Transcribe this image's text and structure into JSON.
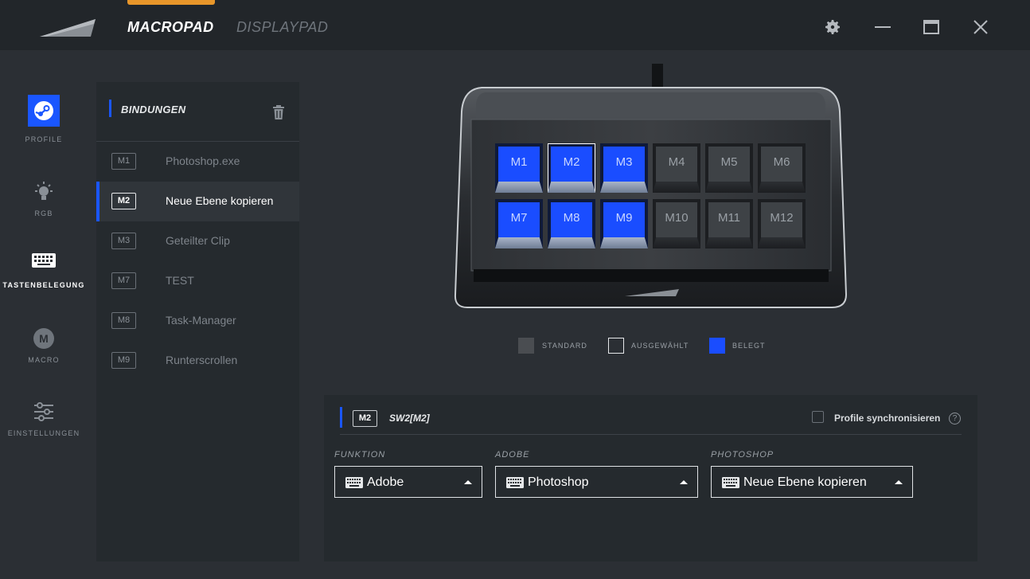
{
  "header": {
    "tab_active": "MACROPAD",
    "tab_inactive": "DISPLAYPAD",
    "accent_color": "#e8962a"
  },
  "nav": {
    "items": [
      {
        "label": "PROFILE",
        "icon": "steam-icon"
      },
      {
        "label": "RGB",
        "icon": "lightbulb-icon"
      },
      {
        "label": "TASTENBELEGUNG",
        "icon": "keyboard-icon"
      },
      {
        "label": "MACRO",
        "icon": "macro-m-icon"
      },
      {
        "label": "EINSTELLUNGEN",
        "icon": "sliders-icon"
      }
    ]
  },
  "bindings": {
    "title": "BINDUNGEN",
    "rows": [
      {
        "key": "M1",
        "label": "Photoshop.exe"
      },
      {
        "key": "M2",
        "label": "Neue Ebene kopieren",
        "selected": true
      },
      {
        "key": "M3",
        "label": "Geteilter Clip"
      },
      {
        "key": "M7",
        "label": "TEST"
      },
      {
        "key": "M8",
        "label": "Task-Manager"
      },
      {
        "key": "M9",
        "label": "Runterscrollen"
      }
    ]
  },
  "keys": [
    {
      "label": "M1",
      "state": "assigned"
    },
    {
      "label": "M2",
      "state": "assigned",
      "selected": true
    },
    {
      "label": "M3",
      "state": "assigned"
    },
    {
      "label": "M4",
      "state": "standard"
    },
    {
      "label": "M5",
      "state": "standard"
    },
    {
      "label": "M6",
      "state": "standard"
    },
    {
      "label": "M7",
      "state": "assigned"
    },
    {
      "label": "M8",
      "state": "assigned"
    },
    {
      "label": "M9",
      "state": "assigned"
    },
    {
      "label": "M10",
      "state": "standard"
    },
    {
      "label": "M11",
      "state": "standard"
    },
    {
      "label": "M12",
      "state": "standard"
    }
  ],
  "legend": {
    "standard": "STANDARD",
    "selected": "AUSGEWÄHLT",
    "assigned": "BELEGT",
    "assigned_color": "#1a4dff",
    "standard_color": "#4a4d51"
  },
  "config": {
    "key_tag": "M2",
    "key_name": "SW2[M2]",
    "sync_label": "Profile synchronisieren",
    "help": "?",
    "fields": [
      {
        "label": "FUNKTION",
        "value": "Adobe"
      },
      {
        "label": "ADOBE",
        "value": "Photoshop"
      },
      {
        "label": "PHOTOSHOP",
        "value": "Neue Ebene kopieren"
      }
    ]
  }
}
